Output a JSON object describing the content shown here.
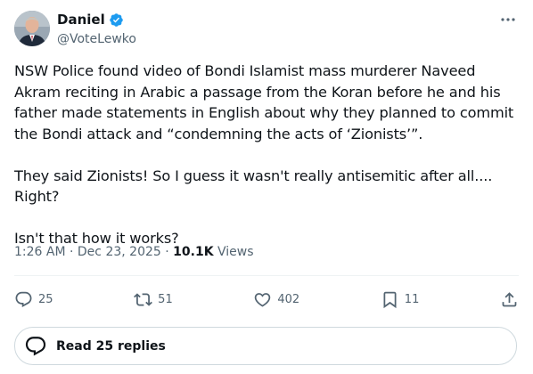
{
  "author": {
    "name": "Daniel",
    "handle": "@VoteLewko",
    "verified_color": "#1d9bf0"
  },
  "tweet": {
    "paragraphs": [
      "NSW Police found video of Bondi Islamist mass murderer Naveed Akram reciting in Arabic a passage from the Koran before he and his father made statements in English about why they planned to commit the Bondi attack and  “condemning the acts of ‘Zionists’”.",
      "They said Zionists! So I guess it wasn't really antisemitic after all.... Right?",
      "Isn't that how it works?"
    ],
    "time": "1:26 AM",
    "separator": "·",
    "date": "Dec 23, 2025",
    "views_count": "10.1K",
    "views_label": "Views"
  },
  "actions": {
    "reply_count": "25",
    "retweet_count": "51",
    "like_count": "402",
    "bookmark_count": "11"
  },
  "replies_button": {
    "label": "Read 25 replies"
  },
  "icons": {
    "more": "more-horizontal-icon",
    "reply": "reply-icon",
    "retweet": "retweet-icon",
    "like": "heart-icon",
    "bookmark": "bookmark-icon",
    "share": "share-icon"
  },
  "colors": {
    "text": "#0f1419",
    "secondary": "#536471",
    "border": "#cfd9de"
  }
}
